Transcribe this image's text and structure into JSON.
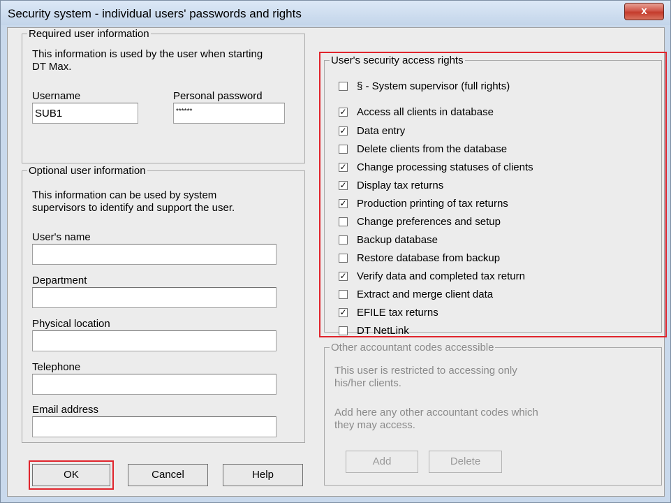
{
  "window": {
    "title": "Security system - individual users' passwords and rights",
    "close_symbol": "x"
  },
  "required": {
    "legend": "Required user information",
    "info_line1": "This information is used by the user when starting",
    "info_line2": "DT Max.",
    "username_label": "Username",
    "username_value": "SUB1",
    "password_label": "Personal password",
    "password_value": "******"
  },
  "optional": {
    "legend": "Optional user information",
    "info_line1": "This information can be used by system",
    "info_line2": "supervisors to identify and support the user.",
    "users_name_label": "User's name",
    "users_name_value": "",
    "department_label": "Department",
    "department_value": "",
    "location_label": "Physical location",
    "location_value": "",
    "telephone_label": "Telephone",
    "telephone_value": "",
    "email_label": "Email address",
    "email_value": ""
  },
  "rights": {
    "legend": "User's security access rights",
    "items": [
      {
        "label": "§ - System supervisor (full rights)",
        "checked": false
      },
      {
        "label": "Access all clients in database",
        "checked": true
      },
      {
        "label": "Data entry",
        "checked": true
      },
      {
        "label": "Delete clients from the database",
        "checked": false
      },
      {
        "label": "Change processing statuses of clients",
        "checked": true
      },
      {
        "label": "Display tax returns",
        "checked": true
      },
      {
        "label": "Production printing of tax returns",
        "checked": true
      },
      {
        "label": "Change preferences and setup",
        "checked": false
      },
      {
        "label": "Backup database",
        "checked": false
      },
      {
        "label": "Restore database from backup",
        "checked": false
      },
      {
        "label": "Verify data and completed tax return",
        "checked": true
      },
      {
        "label": "Extract and merge client data",
        "checked": false
      },
      {
        "label": "EFILE tax returns",
        "checked": true
      },
      {
        "label": "DT NetLink",
        "checked": false
      }
    ]
  },
  "other_codes": {
    "legend": "Other accountant codes accessible",
    "info_line1": "This user is restricted to accessing only",
    "info_line2": "his/her clients.",
    "info_line3": "Add here any other accountant codes which",
    "info_line4": "they may access.",
    "add_label": "Add",
    "delete_label": "Delete"
  },
  "buttons": {
    "ok": "OK",
    "cancel": "Cancel",
    "help": "Help"
  },
  "colors": {
    "highlight": "#e0242c",
    "close_button": "#c43b2c",
    "titlebar": "#c9d9ec"
  }
}
